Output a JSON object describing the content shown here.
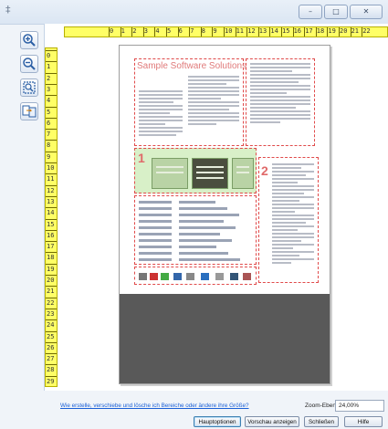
{
  "window": {
    "app_icon": "‡",
    "buttons": [
      "–",
      "□",
      "✕"
    ]
  },
  "tools": [
    "zoom-in-icon",
    "zoom-out-icon",
    "zoom-fit-icon",
    "page-compare-icon"
  ],
  "ruler": {
    "top_numbers": [
      "0",
      "1",
      "2",
      "3",
      "4",
      "5",
      "6",
      "7",
      "8",
      "9",
      "10",
      "11",
      "12",
      "13",
      "14",
      "15",
      "16",
      "17",
      "18",
      "19",
      "20",
      "21",
      "22"
    ],
    "left_numbers": [
      "0",
      "1",
      "2",
      "3",
      "4",
      "5",
      "6",
      "7",
      "8",
      "9",
      "10",
      "11",
      "12",
      "13",
      "14",
      "15",
      "16",
      "17",
      "18",
      "19",
      "20",
      "21",
      "22",
      "23",
      "24",
      "25",
      "26",
      "27",
      "28",
      "29"
    ]
  },
  "document": {
    "title": "Sample Software Solutions",
    "region_numbers": [
      "1",
      "2"
    ]
  },
  "footer": {
    "help_link": "Wie erstelle, verschiebe und lösche ich Bereiche oder ändere ihre Größe?",
    "zoom_label": "Zoom-Ebene:",
    "zoom_value": "24,00%",
    "buttons": {
      "main_options": "Hauptoptionen",
      "show_preview": "Vorschau anzeigen",
      "close": "Schließen",
      "help": "Hilfe"
    }
  },
  "colors": {
    "ruler": "#ffff66",
    "region_border": "#e04b4b",
    "selected_region": "#d8f0c8",
    "link": "#1a5fd6"
  }
}
